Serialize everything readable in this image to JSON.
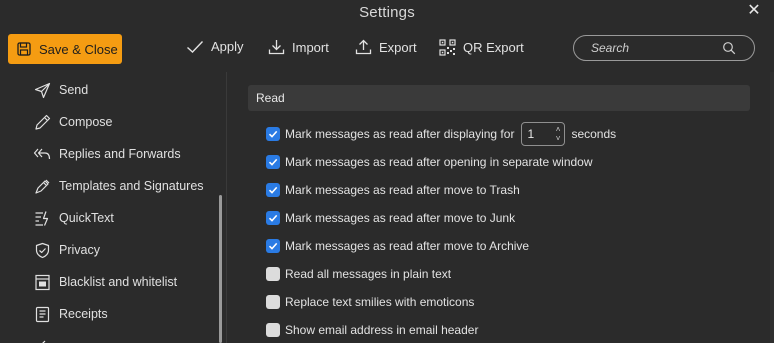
{
  "window": {
    "title": "Settings"
  },
  "toolbar": {
    "save_label": "Save & Close",
    "apply_label": "Apply",
    "import_label": "Import",
    "export_label": "Export",
    "qr_export_label": "QR Export"
  },
  "search": {
    "placeholder": "Search"
  },
  "sidebar": {
    "items": [
      {
        "label": "Send",
        "icon": "send-icon"
      },
      {
        "label": "Compose",
        "icon": "pencil-icon"
      },
      {
        "label": "Replies and Forwards",
        "icon": "reply-all-icon"
      },
      {
        "label": "Templates and Signatures",
        "icon": "signature-pen-icon"
      },
      {
        "label": "QuickText",
        "icon": "quicktext-icon"
      },
      {
        "label": "Privacy",
        "icon": "shield-icon"
      },
      {
        "label": "Blacklist and whitelist",
        "icon": "blacklist-icon"
      },
      {
        "label": "Receipts",
        "icon": "receipt-icon"
      }
    ]
  },
  "main": {
    "section_title": "Read",
    "display_option": {
      "label": "Mark messages as read after displaying for",
      "seconds_value": "1",
      "suffix": "seconds",
      "checked": true
    },
    "options": [
      {
        "label": "Mark messages as read after opening in separate window",
        "checked": true
      },
      {
        "label": "Mark messages as read after move to Trash",
        "checked": true
      },
      {
        "label": "Mark messages as read after move to Junk",
        "checked": true
      },
      {
        "label": "Mark messages as read after move to Archive",
        "checked": true
      },
      {
        "label": "Read all messages in plain text",
        "checked": false
      },
      {
        "label": "Replace text smilies with emoticons",
        "checked": false
      },
      {
        "label": "Show email address in email header",
        "checked": false
      }
    ]
  },
  "colors": {
    "accent": "#f59c12",
    "checkbox_checked": "#2a7be4",
    "background": "#2b2b2b",
    "section_header": "#3a3a3a"
  }
}
